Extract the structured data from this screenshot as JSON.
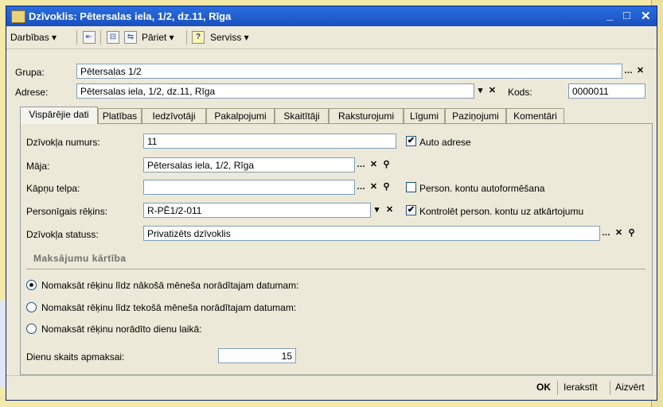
{
  "window": {
    "title": "Dzīvoklis: Pētersalas iela, 1/2, dz.11, Rīga",
    "minimize": "_",
    "maximize": "□",
    "close": "✕"
  },
  "toolbar": {
    "actions_menu": "Darbības ▾",
    "goto_menu": "Pāriet ▾",
    "help_label": "?",
    "service_menu": "Serviss ▾"
  },
  "header": {
    "group_label": "Grupa:",
    "group_value": "Pētersalas 1/2",
    "address_label": "Adrese:",
    "address_value": "Pētersalas iela, 1/2, dz.11, Rīga",
    "code_label": "Kods:",
    "code_value": "0000011"
  },
  "tabs": [
    "Vispārējie dati",
    "Platības",
    "Iedzīvotāji",
    "Pakalpojumi",
    "Skaitītāji",
    "Raksturojumi",
    "Līgumi",
    "Paziņojumi",
    "Komentāri"
  ],
  "form": {
    "apartment_number_label": "Dzīvokļa numurs:",
    "apartment_number_value": "11",
    "auto_address_label": "Auto adrese",
    "house_label": "Māja:",
    "house_value": "Pētersalas iela, 1/2, Rīga",
    "stairwell_label": "Kāpņu telpa:",
    "stairwell_value": "",
    "person_accounts_label": "Person. kontu autoformēšana",
    "personal_account_label": "Personīgais rēķins:",
    "personal_account_value": "R-PĒ1/2-011",
    "control_accounts_label": "Kontrolēt person. kontu uz atkārtojumu",
    "status_label": "Dzīvokļa statuss:",
    "status_value": "Privatizēts dzīvoklis"
  },
  "payment": {
    "section_title": "Maksājumu kārtība",
    "options": [
      "Nomaksāt rēķinu līdz nākošā mēneša norādītajam datumam:",
      "Nomaksāt rēķinu līdz tekošā mēneša norādītajam datumam:",
      "Nomaksāt rēķinu norādīto dienu laikā:"
    ],
    "selected_index": 0,
    "days_label": "Dienu skaits apmaksai:",
    "days_value": "15"
  },
  "bottom": {
    "ok": "OK",
    "save": "Ierakstīt",
    "close": "Aizvērt"
  },
  "colors": {
    "titlebar": "#1a4fbe",
    "window_bg": "#ece9d8",
    "desktop": "#f3e9a8"
  }
}
